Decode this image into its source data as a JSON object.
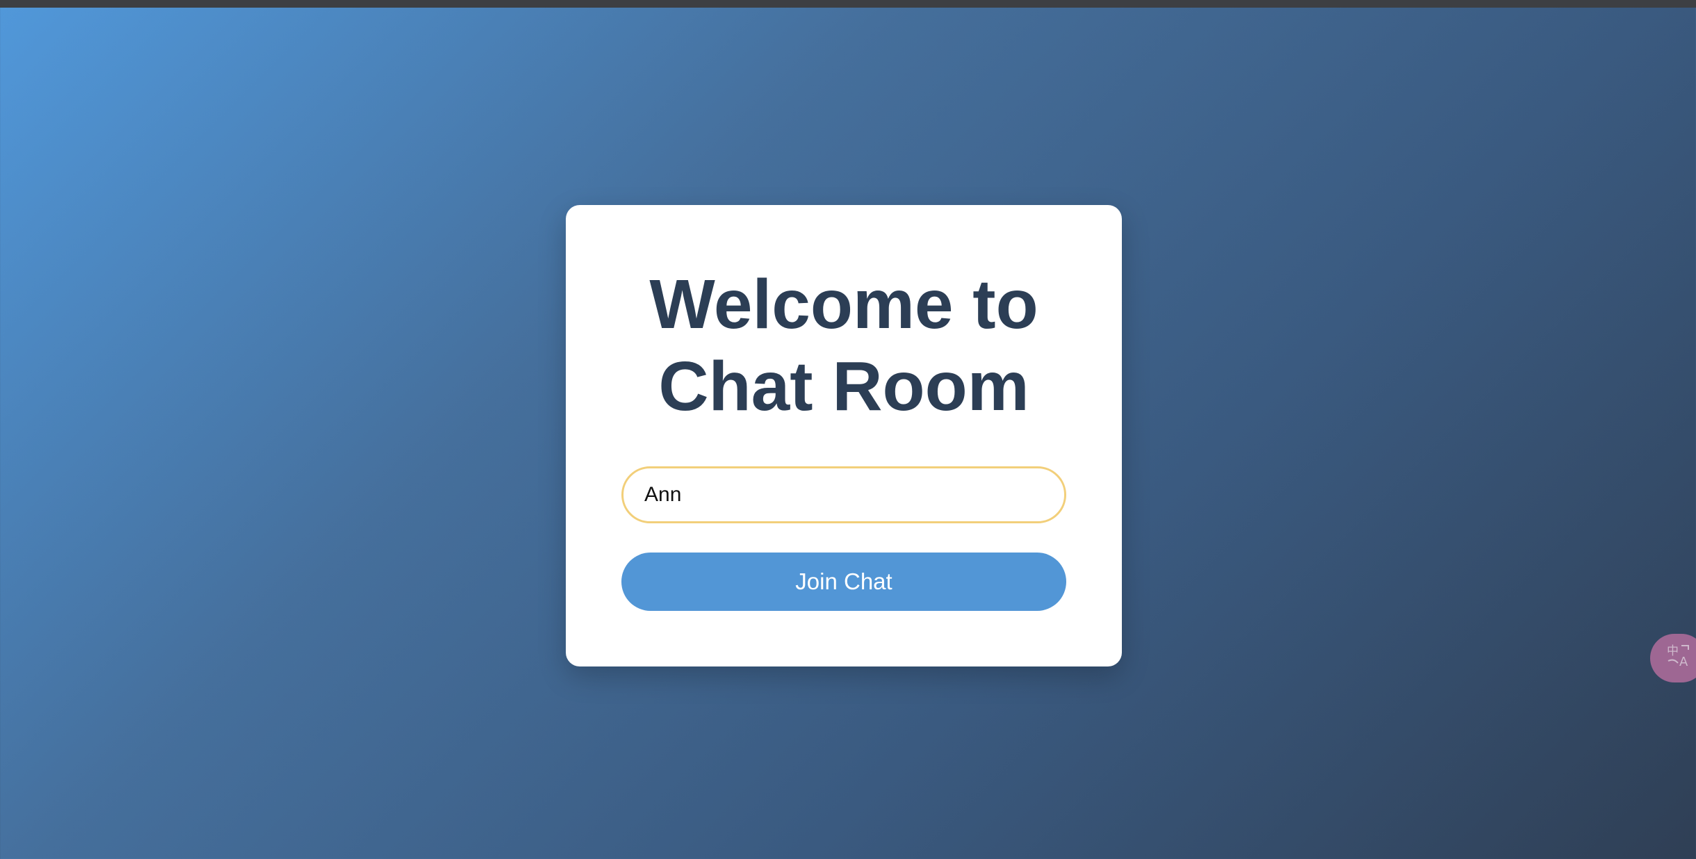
{
  "window": {
    "title_line_1": "Welcome to",
    "title_line_2": "Chat Room"
  },
  "form": {
    "name_value": "Ann",
    "join_label": "Join Chat"
  },
  "translate_widget": {
    "icon": "translate-icon"
  },
  "colors": {
    "background_start": "#5198da",
    "background_end": "#2f3f55",
    "card": "#ffffff",
    "title": "#2c3e55",
    "input_border": "#f2cf7a",
    "button": "#5296d6",
    "button_text": "#ffffff",
    "translate_widget": "#a86a98"
  }
}
